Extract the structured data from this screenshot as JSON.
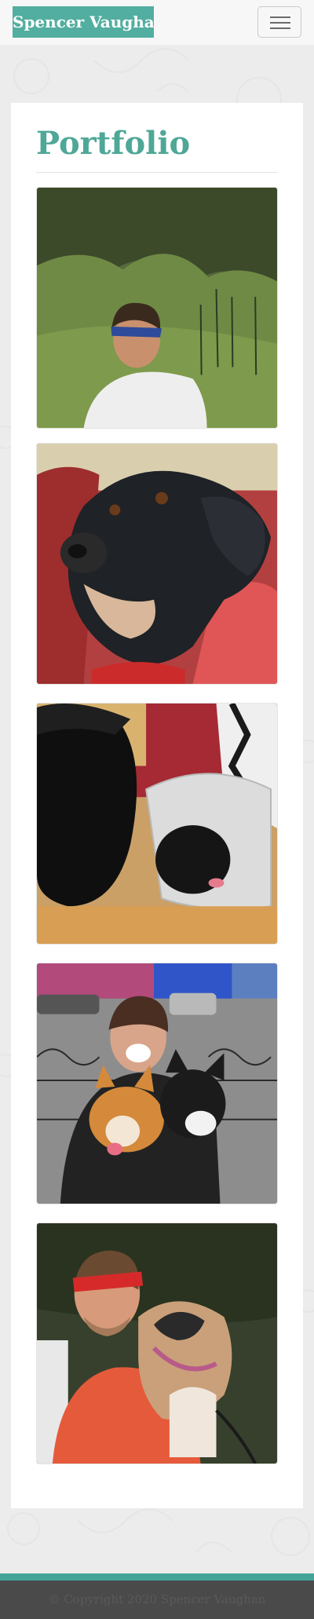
{
  "navbar": {
    "brand": "Spencer Vaughan",
    "menu_icon": "hamburger-menu-icon"
  },
  "portfolio": {
    "title": "Portfolio",
    "photos": [
      {
        "subject": "man-in-mountain-valley"
      },
      {
        "subject": "black-dog-closeup"
      },
      {
        "subject": "two-dogs-with-cone"
      },
      {
        "subject": "man-holding-two-corgis"
      },
      {
        "subject": "man-with-headband-holding-dog"
      }
    ]
  },
  "footer": {
    "copyright": "© Copyright 2020 Spencer Vaughan"
  },
  "colors": {
    "brand_bg": "#52aea0",
    "title": "#4ea797",
    "footer_accent": "#43a598",
    "footer_bg": "#4a4a4a"
  }
}
